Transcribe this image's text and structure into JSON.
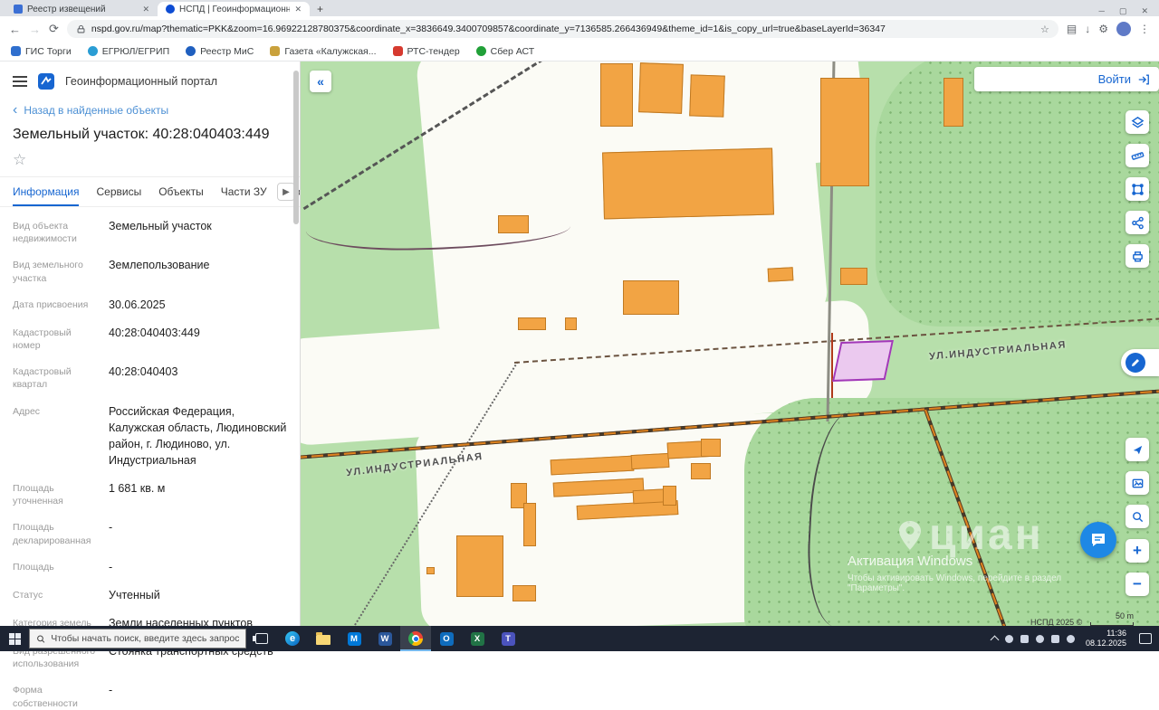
{
  "browser": {
    "tab1": "Реестр извещений",
    "tab2": "НСПД | Геоинформационный п",
    "new_tab_glyph": "+",
    "url": "nspd.gov.ru/map?thematic=PKK&zoom=16.96922128780375&coordinate_x=3836649.3400709857&coordinate_y=7136585.266436949&theme_id=1&is_copy_url=true&baseLayerId=36347",
    "bookmarks": [
      "ГИС Торги",
      "ЕГРЮЛ/ЕГРИП",
      "Реестр МиС",
      "Газета «Калужская...",
      "РТС-тендер",
      "Сбер АСТ"
    ]
  },
  "panel": {
    "app_title": "Геоинформационный портал",
    "back_link": "Назад в найденные объекты",
    "title": "Земельный участок: 40:28:040403:449",
    "star_glyph": "☆",
    "tabs": [
      "Информация",
      "Сервисы",
      "Объекты",
      "Части ЗУ",
      "Соста"
    ],
    "fields": [
      {
        "label": "Вид объекта недвижимости",
        "value": "Земельный участок"
      },
      {
        "label": "Вид земельного участка",
        "value": "Землепользование"
      },
      {
        "label": "Дата присвоения",
        "value": "30.06.2025"
      },
      {
        "label": "Кадастровый номер",
        "value": "40:28:040403:449"
      },
      {
        "label": "Кадастровый квартал",
        "value": "40:28:040403"
      },
      {
        "label": "Адрес",
        "value": "Российская Федерация, Калужская область, Людиновский район, г. Людиново, ул. Индустриальная"
      },
      {
        "label": "Площадь уточненная",
        "value": "1 681 кв. м"
      },
      {
        "label": "Площадь декларированная",
        "value": "-"
      },
      {
        "label": "Площадь",
        "value": "-"
      },
      {
        "label": "Статус",
        "value": "Учтенный"
      },
      {
        "label": "Категория земель",
        "value": "Земли населенных пунктов"
      },
      {
        "label": "Вид разрешенного использования",
        "value": "Стоянка транспортных средств"
      },
      {
        "label": "Форма собственности",
        "value": "-"
      }
    ]
  },
  "map": {
    "login": "Войти",
    "collapse_glyph": "«",
    "street": "УЛ.ИНДУСТРИАЛЬНАЯ",
    "watermark": "циан",
    "activation1": "Активация Windows",
    "activation2": "Чтобы активировать Windows, перейдите в раздел \"Параметры\".",
    "attribution": "НСПД 2025 ©",
    "scale": "50 m",
    "zoom_in_glyph": "+",
    "zoom_out_glyph": "−"
  },
  "taskbar": {
    "search_placeholder": "Чтобы начать поиск, введите здесь запрос",
    "time": "11:36",
    "date": "08.12.2025"
  },
  "colors": {
    "accent": "#1766d1",
    "map_green": "#b7dfab",
    "forest_green": "#a9d89d",
    "building_orange": "#f2a444",
    "parcel_fill": "#ebc9ef",
    "parcel_stroke": "#a238b8",
    "taskbar_bg": "#1d2433"
  }
}
